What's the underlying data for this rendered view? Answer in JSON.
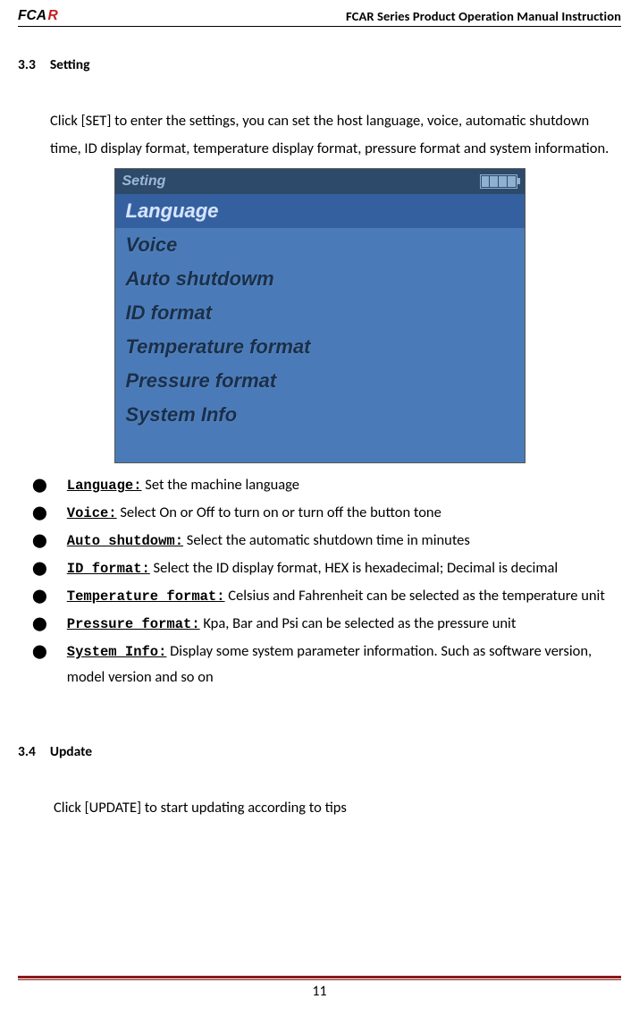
{
  "header": {
    "logo_text": "FCAR",
    "title": "FCAR Series Product  Operation Manual Instruction"
  },
  "section_33": {
    "number": "3.3",
    "title": "Setting",
    "intro": "Click [SET] to enter the settings, you can set the host language, voice, automatic shutdown time, ID display format, temperature display format, pressure format and system information."
  },
  "screenshot": {
    "topbar": "Seting",
    "items": [
      "Language",
      "Voice",
      "Auto shutdowm",
      "ID format",
      "Temperature format",
      "Pressure format",
      "System Info"
    ],
    "selected_index": 0
  },
  "bullets": [
    {
      "label": "Language:",
      "text": " Set the machine language"
    },
    {
      "label": "Voice:",
      "text": " Select On or Off to turn on or turn off the button tone"
    },
    {
      "label": "Auto shutdowm:",
      "text": " Select the automatic shutdown time in minutes"
    },
    {
      "label": "ID format:",
      "text": "  Select the ID display format, HEX is hexadecimal; Decimal is decimal"
    },
    {
      "label": "Temperature format:",
      "text": "  Celsius and Fahrenheit can be selected as the temperature unit"
    },
    {
      "label": "Pressure format:",
      "text": "  Kpa, Bar and Psi can be selected as the pressure unit"
    },
    {
      "label": "System Info:",
      "text": " Display some system parameter information. Such as software version, model version and so on"
    }
  ],
  "section_34": {
    "number": "3.4",
    "title": "Update",
    "intro": "Click [UPDATE] to start updating according to tips"
  },
  "footer": {
    "page": "11"
  }
}
